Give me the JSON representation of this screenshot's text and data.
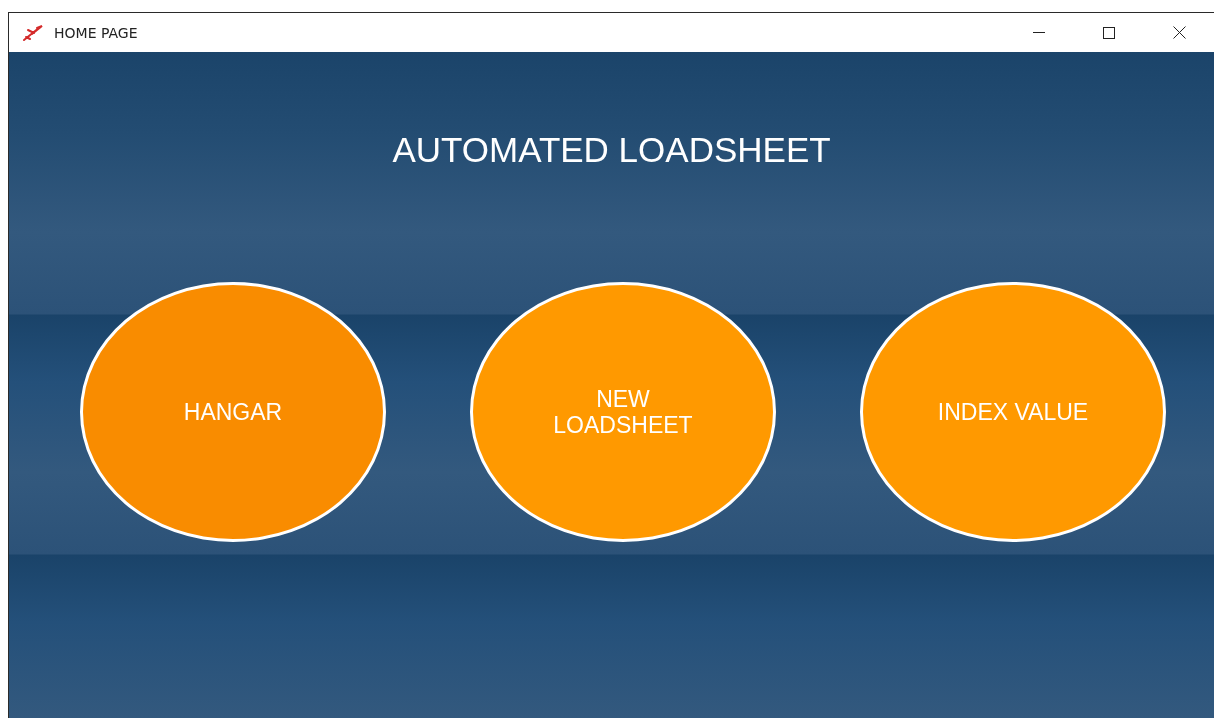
{
  "window": {
    "title": "HOME PAGE"
  },
  "heading": "AUTOMATED LOADSHEET",
  "buttons": [
    {
      "label": "HANGAR",
      "hovered": true
    },
    {
      "label": "NEW\nLOADSHEET",
      "hovered": false
    },
    {
      "label": "INDEX VALUE",
      "hovered": false
    }
  ]
}
